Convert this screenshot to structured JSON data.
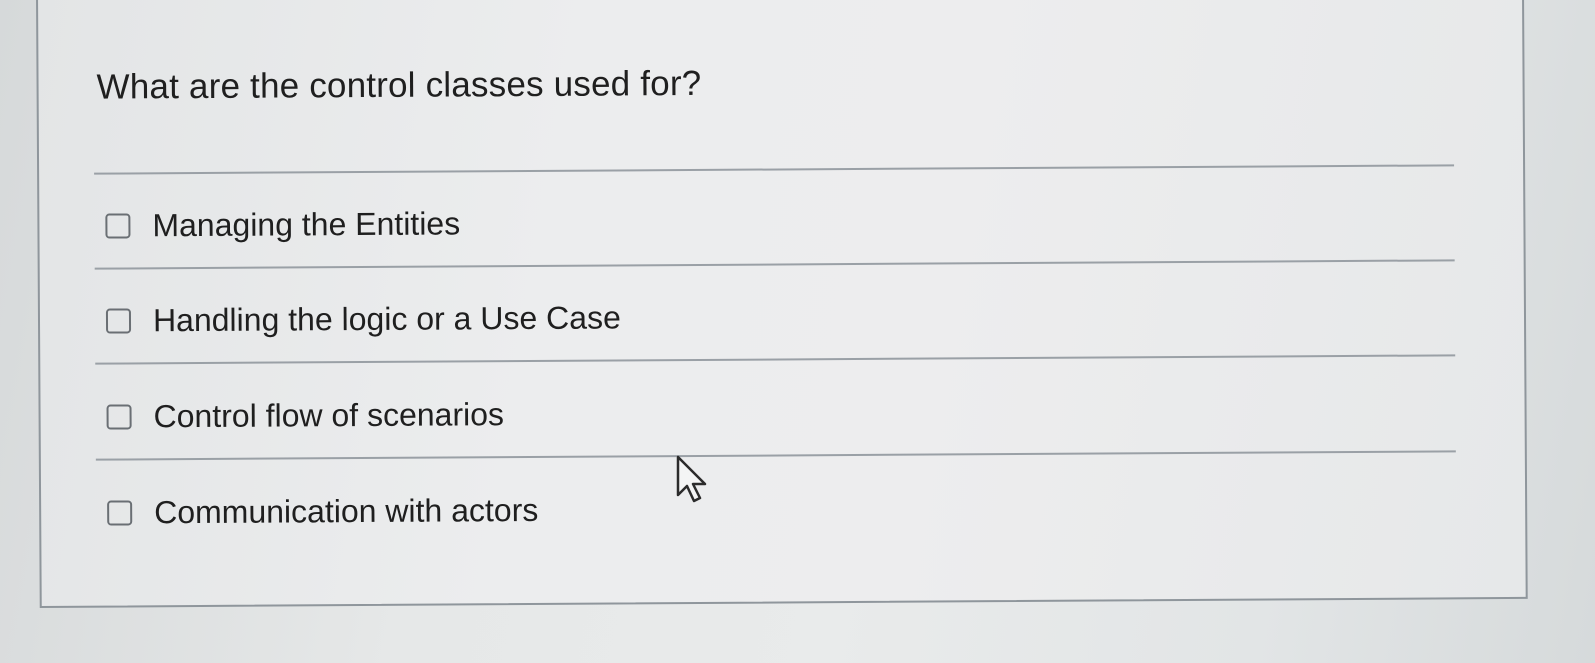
{
  "quiz": {
    "question": "What are the control classes used for?",
    "options": [
      {
        "label": "Managing the Entities",
        "checked": false
      },
      {
        "label": "Handling the logic or a Use Case",
        "checked": false
      },
      {
        "label": "Control flow of scenarios",
        "checked": false
      },
      {
        "label": "Communication with actors",
        "checked": false
      }
    ]
  },
  "icons": {
    "checkbox": "checkbox-unchecked-icon",
    "cursor": "mouse-pointer-icon"
  }
}
